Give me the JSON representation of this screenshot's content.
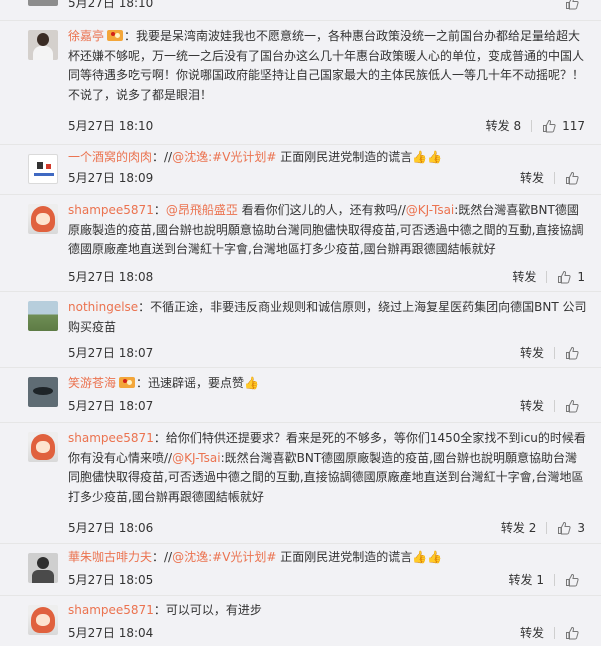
{
  "comments": [
    {
      "time": "5月27日 18:10",
      "repost_label": "",
      "like_count": ""
    },
    {
      "user": "徐嘉亭",
      "text": "：我要是呆湾南波娃我也不愿意统一，各种惠台政策没统一之前国台办都给足量给超大杯还嫌不够呢，万一统一之后没有了国台办这么几十年惠台政策暖人心的单位，变成普通的中国人同等待遇多吃亏啊！你说哪国政府能坚持让自己国家最大的主体民族低人一等几十年不动摇呢？！不说了，说多了都是眼泪！",
      "time": "5月27日 18:10",
      "repost_label": "转发",
      "repost_count": "8",
      "like_count": "117"
    },
    {
      "user": "一个酒窝的肉肉",
      "text_prefix": "：//",
      "mention": "@沈逸:#V光计划#",
      "text": " 正面刚民进党制造的谎言",
      "emoji": "👍👍",
      "time": "5月27日 18:09",
      "repost_label": "转发",
      "like_count": ""
    },
    {
      "user": "shampee5871",
      "text_prefix": "：",
      "mention1": "@昂飛船盛亞",
      "text1": " 看看你们这儿的人，还有救吗//",
      "mention2": "@KJ-Tsai",
      "text2": ":既然台灣喜歡BNT德國原廠製造的疫苗,國台辦也說明願意協助台灣同胞儘快取得疫苗,可否透過中德之間的互動,直接協調德國原廠產地直送到台灣紅十字會,台灣地區打多少疫苗,國台辦再跟德國結帳就好",
      "time": "5月27日 18:08",
      "repost_label": "转发",
      "like_count": "1"
    },
    {
      "user": "nothingelse",
      "text": "：不循正途，非要违反商业规则和诚信原则，绕过上海复星医药集团向德国BNT 公司购买疫苗",
      "time": "5月27日 18:07",
      "repost_label": "转发",
      "like_count": ""
    },
    {
      "user": "笑游苍海",
      "text": "：迅速辟谣，要点赞",
      "emoji": "👍",
      "time": "5月27日 18:07",
      "repost_label": "转发",
      "like_count": ""
    },
    {
      "user": "shampee5871",
      "text1": "：给你们特供还提要求？看来是死的不够多，等你们1450全家找不到icu的时候看你有没有心情来喷//",
      "mention": "@KJ-Tsai",
      "text2": ":既然台灣喜歡BNT德國原廠製造的疫苗,國台辦也說明願意協助台灣同胞儘快取得疫苗,可否透過中德之間的互動,直接協調德國原廠產地直送到台灣紅十字會,台灣地區打多少疫苗,國台辦再跟德國結帳就好",
      "time": "5月27日 18:06",
      "repost_label": "转发",
      "repost_count": "2",
      "like_count": "3"
    },
    {
      "user": "華朱咖古啡力夫",
      "text_prefix": "：//",
      "mention": "@沈逸:#V光计划#",
      "text": " 正面刚民进党制造的谎言",
      "emoji": "👍👍",
      "time": "5月27日 18:05",
      "repost_label": "转发",
      "repost_count": "1",
      "like_count": ""
    },
    {
      "user": "shampee5871",
      "text": "：可以可以，有进步",
      "time": "5月27日 18:04",
      "repost_label": "转发",
      "like_count": ""
    }
  ],
  "colors": {
    "background": "#f2f2f5",
    "username": "#eb7350",
    "text": "#333333",
    "divider": "#e6e6e6"
  },
  "icons": {
    "like": "thumbs-up-outline-icon",
    "vip": "vip-badge-icon"
  }
}
